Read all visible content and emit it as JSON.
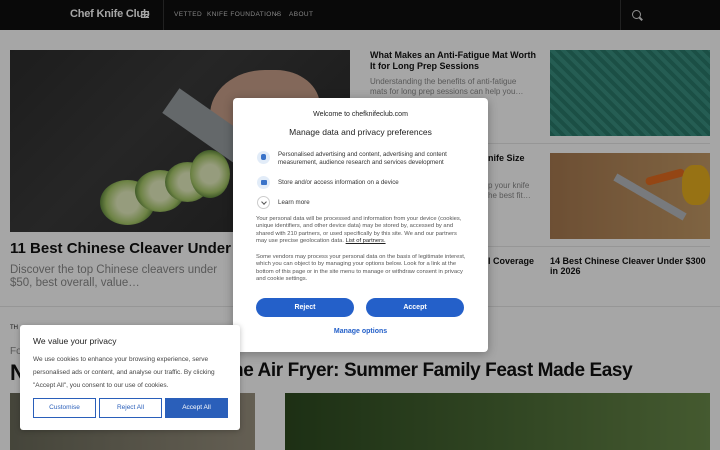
{
  "header": {
    "logo": "Chef Knife Club",
    "nav": [
      "VETTED",
      "KNIFE FOUNDATIONS",
      "ABOUT"
    ],
    "nav_chevron": "⌄"
  },
  "articles": {
    "hero_title": "11 Best Chinese Cleaver Under $50",
    "hero_excerpt": "Discover the top Chinese cleavers under $50, best overall, value…",
    "mat_title": "What Makes an Anti-Fatigue Mat Worth It for Long Prep Sessions",
    "mat_excerpt": "Understanding the benefits of anti-fatigue mats for long prep sessions can help you…",
    "knife_size_fragment": "nife Size",
    "knife_excerpt1": "p your knife",
    "knife_excerpt2": "he best fit…",
    "coverage_fragment": "l Coverage",
    "cleaver300_title": "14 Best Chinese Cleaver Under $300 in 2026",
    "section_label_fragment": "TH",
    "for_fragment": "Fo",
    "big_headline": "ne Air Fryer: Summer Family Feast Made Easy",
    "big_n": "N"
  },
  "consent_modal": {
    "welcome": "Welcome to chefknifeclub.com",
    "title": "Manage data and privacy preferences",
    "purpose1": "Personalised advertising and content, advertising and content measurement, audience research and services development",
    "purpose2": "Store and/or access information on a device",
    "learn_more": "Learn more",
    "para1": "Your personal data will be processed and information from your device (cookies, unique identifiers, and other device data) may be stored by, accessed by and shared with 210 partners, or used specifically by this site. We and our partners may use precise geolocation data.",
    "partners_link": "List of partners.",
    "para2": "Some vendors may process your personal data on the basis of legitimate interest, which you can object to by managing your options below. Look for a link at the bottom of this page or in the site menu to manage or withdraw consent in privacy and cookie settings.",
    "reject": "Reject",
    "accept": "Accept",
    "manage": "Manage options"
  },
  "cookie_banner": {
    "title": "We value your privacy",
    "text": "We use cookies to enhance your browsing experience, serve personalised ads or content, and analyse our traffic. By clicking \"Accept All\", you consent to our use of cookies.",
    "customise": "Customise",
    "reject_all": "Reject All",
    "accept_all": "Accept All"
  },
  "colors": {
    "accent": "#2460c9",
    "header_bg": "#0e0e0e"
  },
  "icons": [
    "menu-icon",
    "search-icon",
    "ad-person-icon",
    "device-storage-icon",
    "chevron-down-icon"
  ]
}
